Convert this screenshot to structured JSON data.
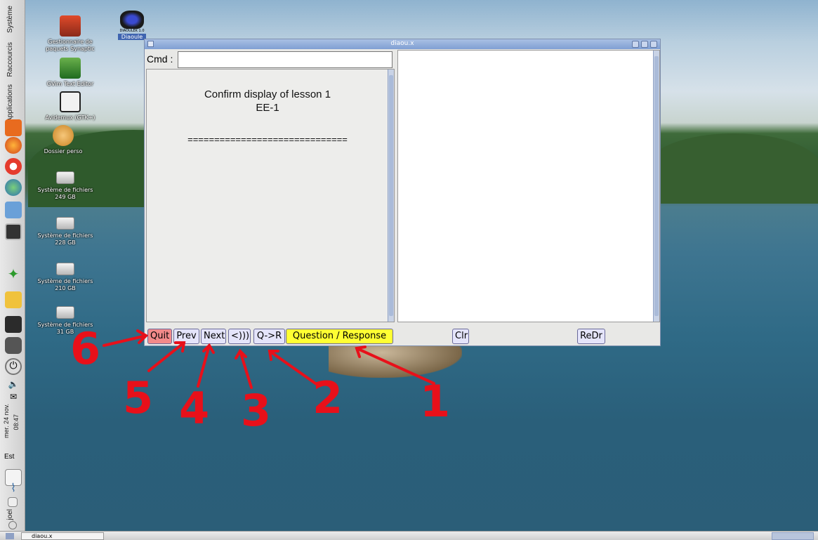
{
  "panel": {
    "menus": [
      "Système",
      "Raccourcis",
      "Applications"
    ],
    "clock": "mer. 24 nov.",
    "time": "08:47",
    "location": "Est",
    "user": "joel"
  },
  "desktop": {
    "icons": [
      {
        "label": "Gestionnaire de paquets Synaptic",
        "icon": "package-manager-icon"
      },
      {
        "label": "GVim Text Editor",
        "icon": "editor-icon"
      },
      {
        "label": "Avidemux (GTK+)",
        "icon": "video-editor-icon"
      },
      {
        "label": "Dossier perso",
        "icon": "home-folder-icon"
      },
      {
        "label": "Système de fichiers 249 GB",
        "icon": "drive-icon"
      },
      {
        "label": "Système de fichiers 228 GB",
        "icon": "drive-icon"
      },
      {
        "label": "Système de fichiers 210 GB",
        "icon": "drive-icon"
      },
      {
        "label": "Système de fichiers 31 GB",
        "icon": "drive-icon"
      }
    ],
    "app_icon_label": "DIAOULEK 1.0",
    "app_icon_sub": "Diaoule"
  },
  "window": {
    "title": "diaou.x",
    "cmd_label": "Cmd :",
    "cmd_value": "",
    "lesson_title": "Confirm display of lesson 1",
    "lesson_code": "EE-1",
    "separator": "=============================="
  },
  "buttons": {
    "quit": "Quit",
    "prev": "Prev",
    "next": "Next",
    "audio": "<)))",
    "qr": "Q->R",
    "question_response": "Question / Response",
    "clr": "Clr",
    "redr": "ReDr"
  },
  "annotations": [
    "6",
    "5",
    "4",
    "3",
    "2",
    "1"
  ],
  "taskbar": {
    "task": "diaou.x"
  },
  "colors": {
    "quit": "#f28a8a",
    "question_response": "#ffff33",
    "button": "#e4e4fa",
    "annotation": "#e8101a",
    "titlebar": "#7f9fd3"
  }
}
